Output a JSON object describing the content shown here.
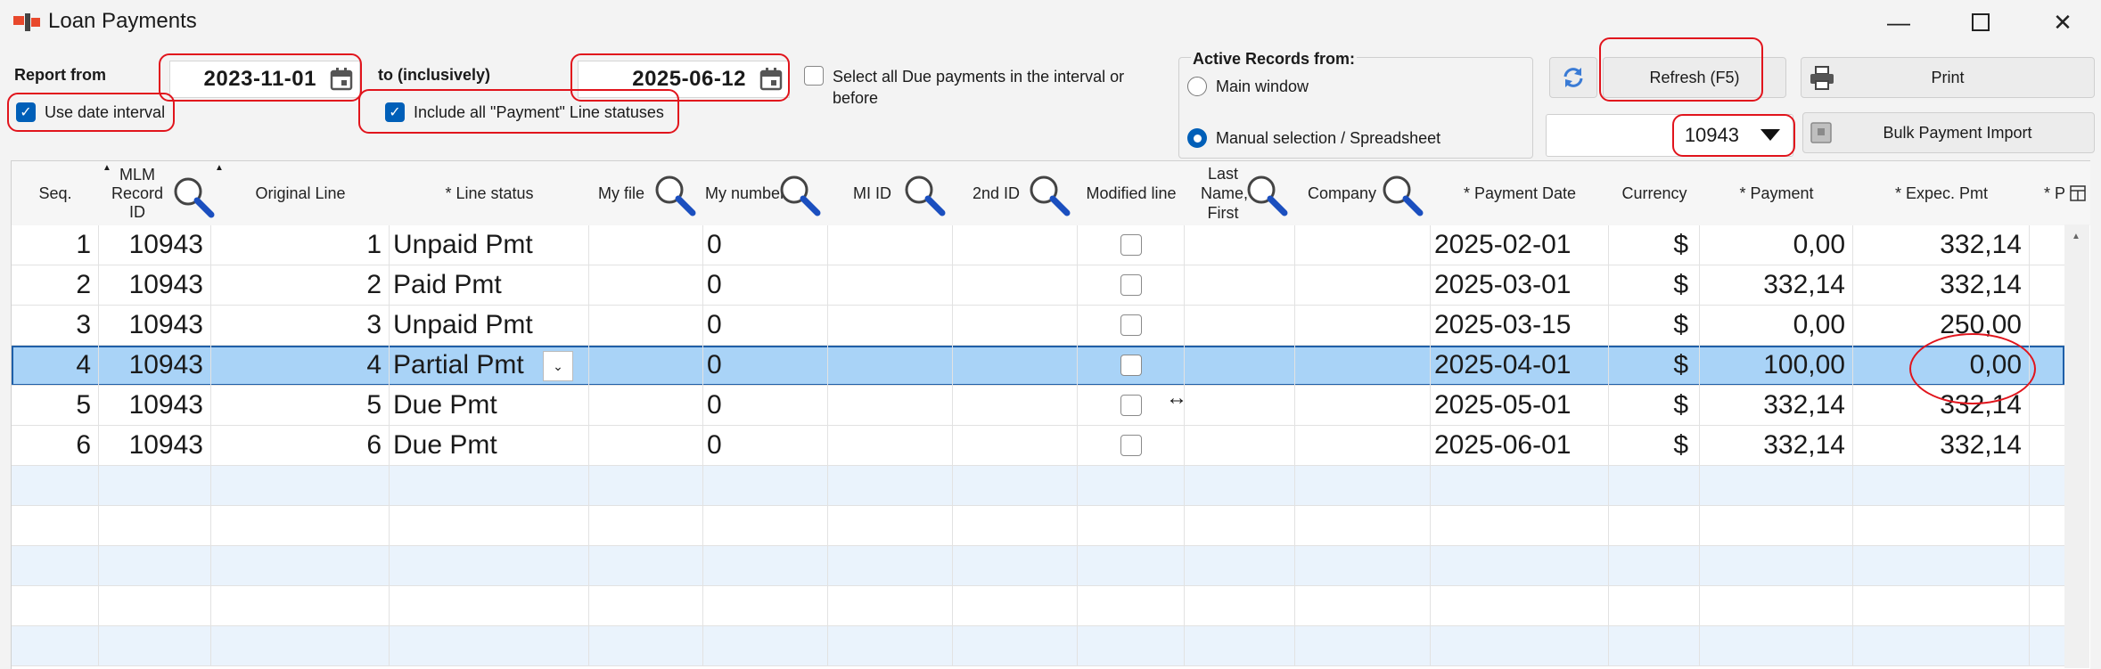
{
  "window": {
    "title": "Loan Payments"
  },
  "toolbar": {
    "report_from_label": "Report from",
    "date_from": "2023-11-01",
    "to_label": "to (inclusively)",
    "date_to": "2025-06-12",
    "use_date_interval_label": "Use date interval",
    "include_all_label": "Include all \"Payment\" Line statuses",
    "select_all_due_label": "Select all Due payments in the interval or before",
    "active_records_label": "Active Records from:",
    "main_window_label": "Main window",
    "manual_selection_label": "Manual selection / Spreadsheet",
    "refresh_label": "Refresh (F5)",
    "print_label": "Print",
    "record_select_value": "10943",
    "bulk_import_label": "Bulk Payment Import"
  },
  "grid": {
    "headers": {
      "seq": "Seq.",
      "mlm_record": "MLM Record ID",
      "original_line": "Original Line",
      "line_status": "* Line status",
      "my_file": "My file",
      "my_number": "My number",
      "mi_id": "MI ID",
      "second_id": "2nd ID",
      "modified_line": "Modified line",
      "last_name": "Last Name, First",
      "company": "Company",
      "payment_date": "* Payment Date",
      "currency": "Currency",
      "payment": "* Payment",
      "expec_pmt": "* Expec. Pmt",
      "overflow": "* P"
    },
    "rows": [
      {
        "seq": "1",
        "record": "10943",
        "orig": "1",
        "status": "Unpaid Pmt",
        "mynum": "0",
        "date": "2025-02-01",
        "cur": "$",
        "pmt": "0,00",
        "exp": "332,14"
      },
      {
        "seq": "2",
        "record": "10943",
        "orig": "2",
        "status": "Paid Pmt",
        "mynum": "0",
        "date": "2025-03-01",
        "cur": "$",
        "pmt": "332,14",
        "exp": "332,14"
      },
      {
        "seq": "3",
        "record": "10943",
        "orig": "3",
        "status": "Unpaid Pmt",
        "mynum": "0",
        "date": "2025-03-15",
        "cur": "$",
        "pmt": "0,00",
        "exp": "250,00"
      },
      {
        "seq": "4",
        "record": "10943",
        "orig": "4",
        "status": "Partial Pmt",
        "mynum": "0",
        "date": "2025-04-01",
        "cur": "$",
        "pmt": "100,00",
        "exp": "0,00"
      },
      {
        "seq": "5",
        "record": "10943",
        "orig": "5",
        "status": "Due Pmt",
        "mynum": "0",
        "date": "2025-05-01",
        "cur": "$",
        "pmt": "332,14",
        "exp": "332,14"
      },
      {
        "seq": "6",
        "record": "10943",
        "orig": "6",
        "status": "Due Pmt",
        "mynum": "0",
        "date": "2025-06-01",
        "cur": "$",
        "pmt": "332,14",
        "exp": "332,14"
      }
    ]
  },
  "colors": {
    "accent": "#005fb8",
    "selected_row": "#a9d3f7",
    "stripe": "#eaf3fc",
    "annotation": "#e1141c"
  },
  "icons": [
    "app-icon",
    "calendar-icon",
    "refresh-icon",
    "printer-icon",
    "magnifier-icon",
    "dropdown-arrow-icon",
    "column-chooser-icon"
  ]
}
